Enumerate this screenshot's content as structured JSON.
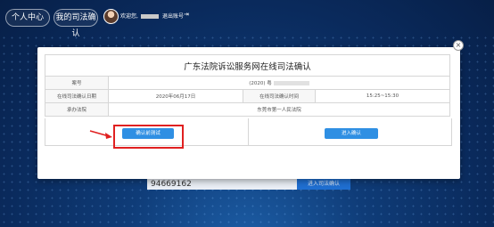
{
  "topbar": {
    "personal_center": "个人中心",
    "my_judicial": "我的司法确认",
    "welcome": "欢迎您,",
    "logout": "退出账号"
  },
  "modal": {
    "title": "广东法院诉讼服务网在线司法确认",
    "rows": [
      {
        "label1": "案号",
        "value1": "(2020) 粤"
      },
      {
        "label1": "在线司法确认日期",
        "value1": "2020年06月17日",
        "label2": "在线司法确认时间",
        "value2": "15:25~15:30"
      },
      {
        "label1": "承办法院",
        "value1": "东莞市第一人民法院"
      }
    ],
    "test_button": "确认前测试",
    "join_button": "进入确认"
  },
  "background": {
    "input_text": "94669162",
    "button_text": "进入司法确认"
  }
}
